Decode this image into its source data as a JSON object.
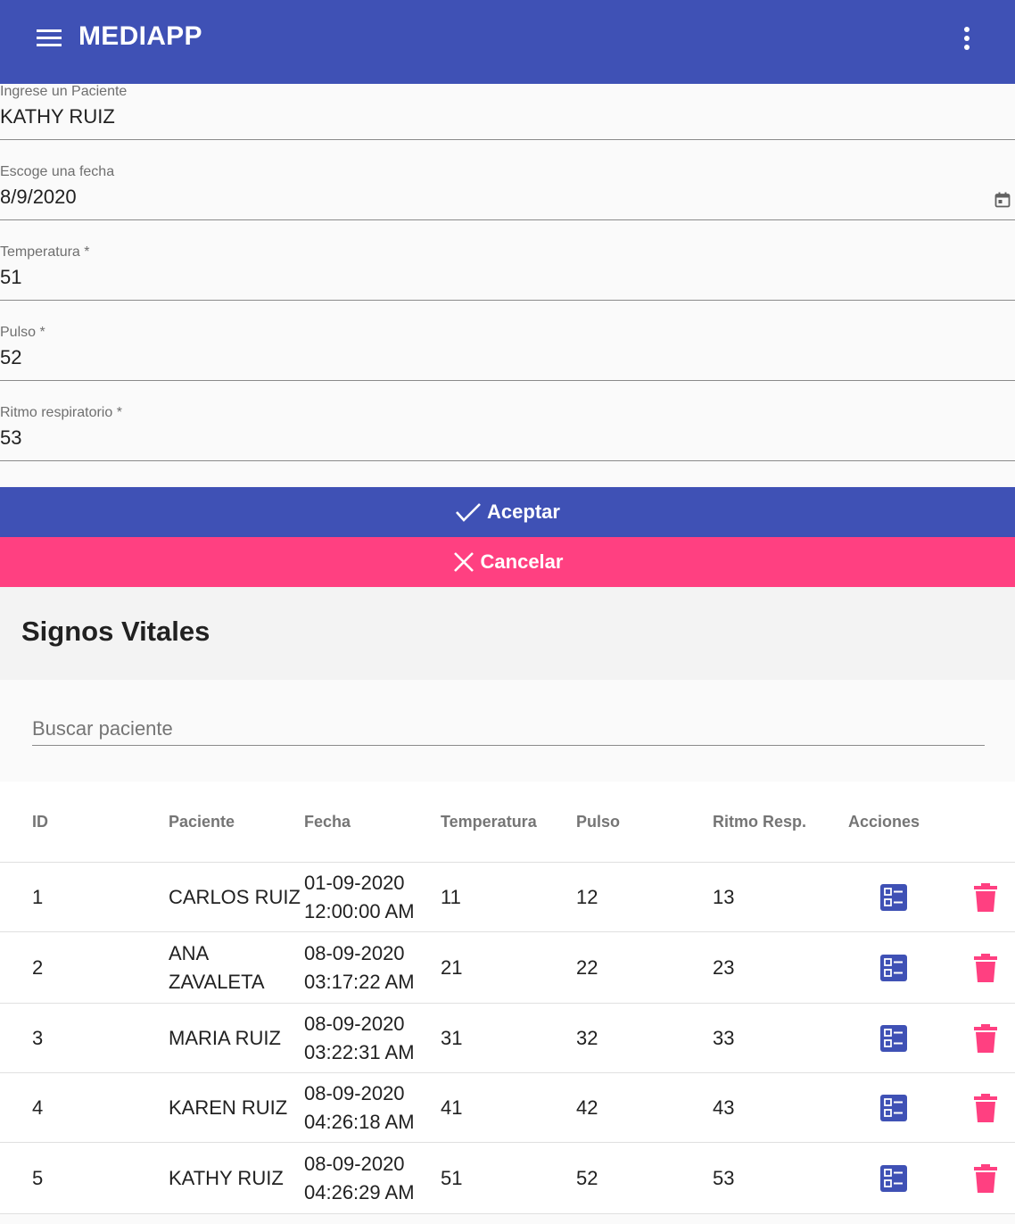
{
  "toolbar": {
    "title": "MEDIAPP",
    "menu_icon": "hamburger-menu-icon",
    "more_icon": "more-vert-icon"
  },
  "form": {
    "patient_label": "Ingrese un Paciente",
    "patient_value": "KATHY RUIZ",
    "date_label": "Escoge una fecha",
    "date_value": "8/9/2020",
    "temp_label": "Temperatura *",
    "temp_value": "51",
    "pulse_label": "Pulso *",
    "pulse_value": "52",
    "resp_label": "Ritmo respiratorio *",
    "resp_value": "53",
    "accept_label": "Aceptar",
    "cancel_label": "Cancelar"
  },
  "list": {
    "title": "Signos Vitales",
    "search_placeholder": "Buscar paciente",
    "headers": [
      "ID",
      "Paciente",
      "Fecha",
      "Temperatura",
      "Pulso",
      "Ritmo Resp.",
      "Acciones"
    ],
    "rows": [
      {
        "id": "1",
        "patient": "CARLOS RUIZ",
        "date": "01-09-2020",
        "time": "12:00:00 AM",
        "temp": "11",
        "pulse": "12",
        "resp": "13"
      },
      {
        "id": "2",
        "patient": "ANA",
        "patient2": "ZAVALETA",
        "date": "08-09-2020",
        "time": "03:17:22 AM",
        "temp": "21",
        "pulse": "22",
        "resp": "23"
      },
      {
        "id": "3",
        "patient": "MARIA RUIZ",
        "date": "08-09-2020",
        "time": "03:22:31 AM",
        "temp": "31",
        "pulse": "32",
        "resp": "33"
      },
      {
        "id": "4",
        "patient": "KAREN RUIZ",
        "date": "08-09-2020",
        "time": "04:26:18 AM",
        "temp": "41",
        "pulse": "42",
        "resp": "43"
      },
      {
        "id": "5",
        "patient": "KATHY RUIZ",
        "date": "08-09-2020",
        "time": "04:26:29 AM",
        "temp": "51",
        "pulse": "52",
        "resp": "53"
      }
    ]
  },
  "colors": {
    "primary": "#3f51b5",
    "accent": "#ff4081"
  }
}
